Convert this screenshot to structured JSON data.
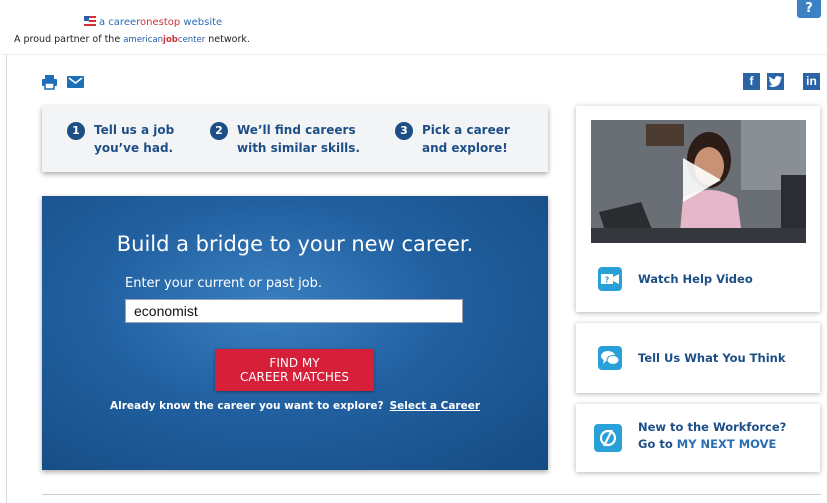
{
  "header": {
    "cos_prefix": "a career",
    "cos_mid": "onestop",
    "cos_suffix": " website",
    "partner_prefix": "A proud partner of the ",
    "ajc_a": "american",
    "ajc_b": "job",
    "ajc_c": "center",
    "partner_suffix": " network.",
    "help_glyph": "?"
  },
  "tools": {
    "print_icon": "printer-icon",
    "email_icon": "envelope-icon"
  },
  "social": {
    "facebook": "f",
    "twitter": "t",
    "linkedin": "in"
  },
  "steps": [
    {
      "num": "1",
      "line1": "Tell us a job",
      "line2": "you’ve had."
    },
    {
      "num": "2",
      "line1": "We’ll find careers",
      "line2": "with similar skills."
    },
    {
      "num": "3",
      "line1": "Pick a career",
      "line2": "and explore!"
    }
  ],
  "hero": {
    "title": "Build a bridge to your new career.",
    "input_label": "Enter your current or past job.",
    "input_value": "economist",
    "button_line1": "FIND MY",
    "button_line2": "CAREER MATCHES",
    "know_text": "Already know the career you want to explore?",
    "select_link": "Select a Career"
  },
  "sidebar": {
    "video_caption": "Watch Help Video",
    "feedback_label": "Tell Us What You Think",
    "workforce_line1": "New to the Workforce?",
    "workforce_line2_prefix": "Go to ",
    "workforce_brand": "MY NEXT MOVE"
  },
  "colors": {
    "brand_blue": "#1d4f86",
    "accent_red": "#d6203a",
    "icon_blue": "#2aa0d8",
    "social_blue": "#2a64a7"
  }
}
